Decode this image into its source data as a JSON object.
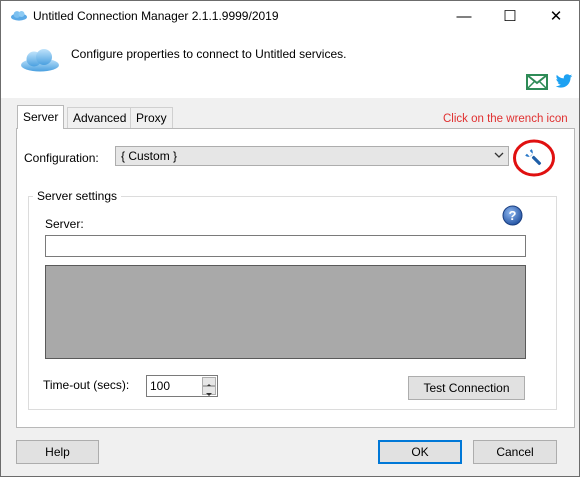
{
  "window": {
    "title": "Untitled Connection Manager 2.1.1.9999/2019",
    "icon": "cloud-icon",
    "controls": {
      "minimize": "—",
      "maximize": "☐",
      "close": "✕"
    }
  },
  "header": {
    "description": "Configure properties to connect to Untitled services.",
    "icons": [
      "cloud-icon",
      "mail-icon",
      "twitter-icon"
    ]
  },
  "tabs": [
    {
      "label": "Server",
      "active": true
    },
    {
      "label": "Advanced",
      "active": false
    },
    {
      "label": "Proxy",
      "active": false
    }
  ],
  "hint": {
    "text": "Click on the wrench icon",
    "color": "#e03030"
  },
  "configuration": {
    "label": "Configuration:",
    "selected": "{ Custom }",
    "wrench_icon": "wrench-icon"
  },
  "server_settings": {
    "group_title": "Server settings",
    "server_label": "Server:",
    "server_value": "",
    "help_icon": "question-icon"
  },
  "timeout": {
    "label": "Time-out (secs):",
    "value": "100"
  },
  "buttons": {
    "test_connection": "Test Connection",
    "help": "Help",
    "ok": "OK",
    "cancel": "Cancel"
  },
  "colors": {
    "accent": "#0078d7",
    "annotation": "#e01010",
    "twitter": "#1da1f2",
    "mail": "#2e8b57"
  }
}
